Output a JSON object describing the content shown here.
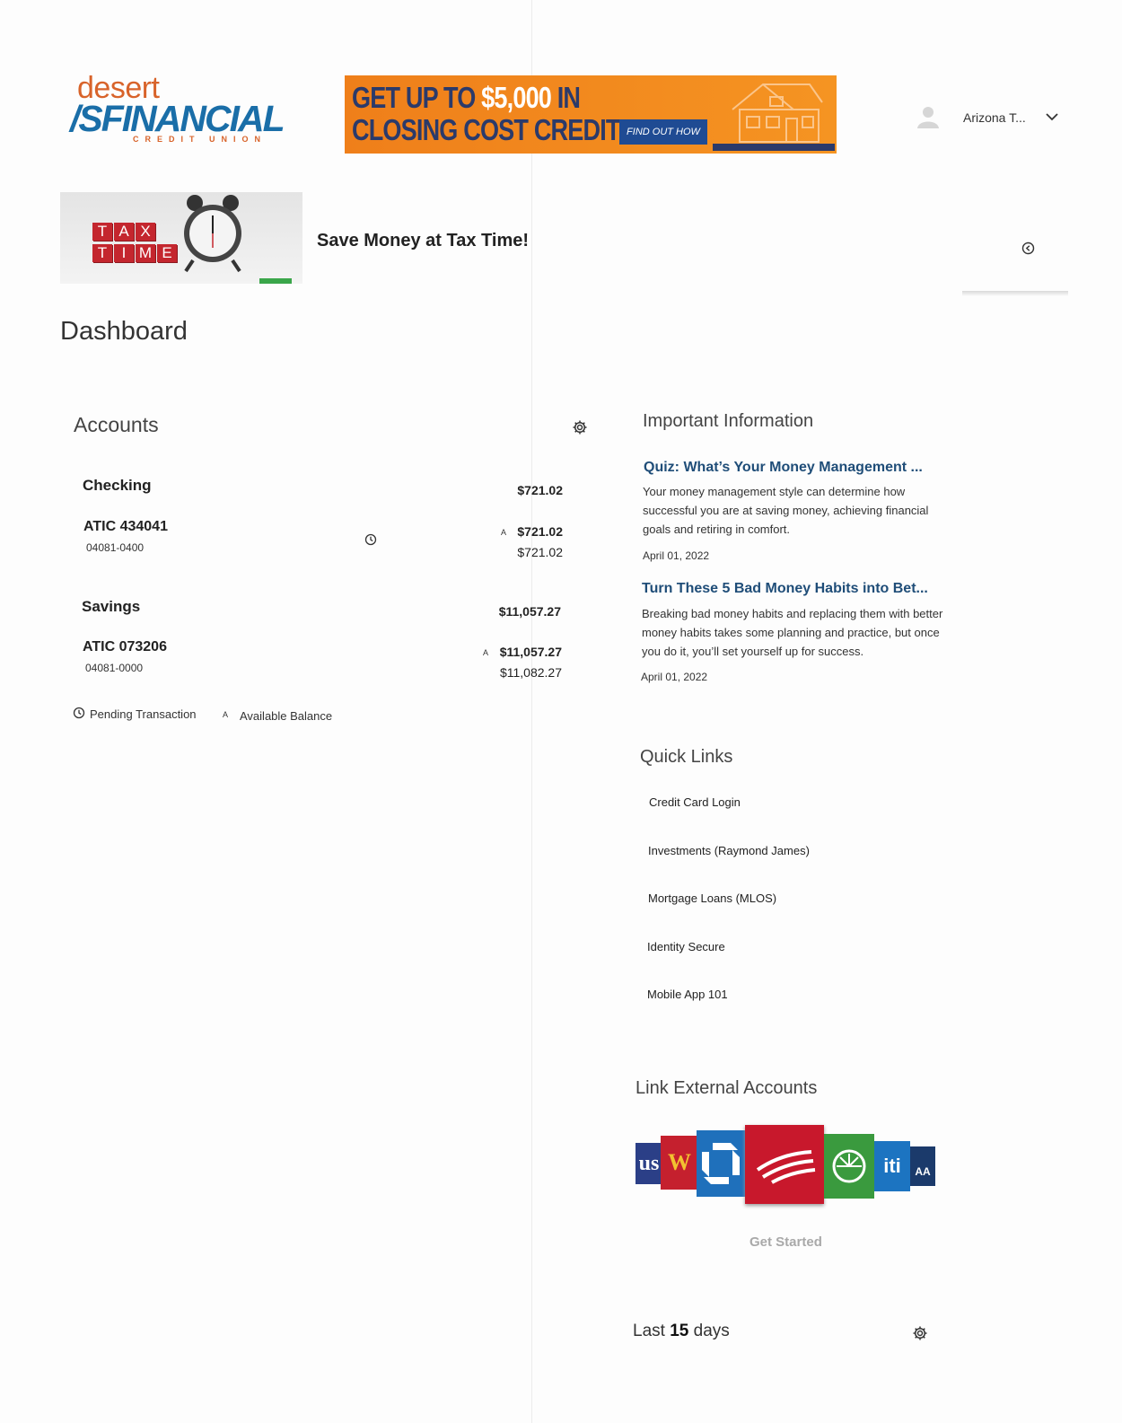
{
  "header": {
    "logo_top": "desert",
    "logo_main": "FINANCIAL",
    "logo_sub": "CREDIT UNION",
    "promo_line1_a": "GET UP TO ",
    "promo_line1_b": "$5,000",
    "promo_line1_c": " IN",
    "promo_line2": "CLOSING COST CREDIT!",
    "promo_button": "FIND OUT HOW",
    "user_name": "Arizona T..."
  },
  "tax_banner": {
    "letters_row1": [
      "T",
      "A",
      "X"
    ],
    "letters_row2": [
      "T",
      "I",
      "M",
      "E"
    ],
    "title": "Save Money at Tax Time!"
  },
  "page_title": "Dashboard",
  "accounts": {
    "title": "Accounts",
    "groups": [
      {
        "name": "Checking",
        "total": "$721.02",
        "items": [
          {
            "name": "ATIC 434041",
            "number": "04081-0400",
            "available": "$721.02",
            "balance": "$721.02",
            "pending": true
          }
        ]
      },
      {
        "name": "Savings",
        "total": "$11,057.27",
        "items": [
          {
            "name": "ATIC 073206",
            "number": "04081-0000",
            "available": "$11,057.27",
            "balance": "$11,082.27",
            "pending": false
          }
        ]
      }
    ],
    "available_marker": "A",
    "legend": {
      "pending": "Pending Transaction",
      "available_marker": "A",
      "available": "Available Balance"
    }
  },
  "important_info": {
    "title": "Important Information",
    "articles": [
      {
        "title": "Quiz: What’s Your Money Management ...",
        "body": "Your money management style can determine how successful you are at saving money, achieving financial goals and retiring in comfort.",
        "date": "April 01, 2022"
      },
      {
        "title": "Turn These 5 Bad Money Habits into Bet...",
        "body": "Breaking bad money habits and replacing them with better money habits takes some planning and practice, but once you do it, you’ll set yourself up for success.",
        "date": "April 01, 2022"
      }
    ]
  },
  "quick_links": {
    "title": "Quick Links",
    "items": [
      "Credit Card Login",
      "Investments (Raymond James)",
      "Mortgage Loans (MLOS)",
      "Identity Secure",
      "Mobile App 101"
    ]
  },
  "external_accounts": {
    "title": "Link External Accounts",
    "logo_text": {
      "usb": "us",
      "wf": "W",
      "citi": "iti",
      "usaa": "AA"
    },
    "cta": "Get Started"
  },
  "last_days": {
    "prefix": "Last ",
    "count": "15",
    "suffix": " days"
  },
  "colors": {
    "brand_orange": "#d8632a",
    "brand_blue": "#1a6ea8",
    "article_title": "#1f4d78",
    "promo_orange": "#ef7f1a"
  }
}
